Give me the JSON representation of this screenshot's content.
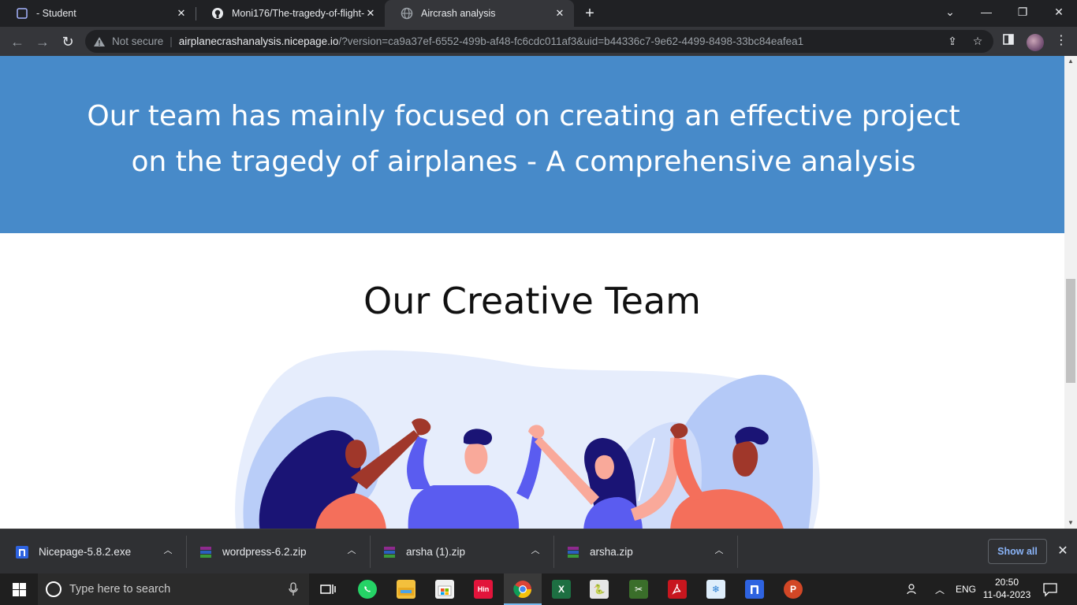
{
  "browser": {
    "tabs": [
      {
        "title": "- Student",
        "icon": "teams-icon",
        "active": false
      },
      {
        "title": "Moni176/The-tragedy-of-flight-",
        "icon": "github-icon",
        "active": false
      },
      {
        "title": "Aircrash analysis",
        "icon": "globe-icon",
        "active": true
      }
    ],
    "address": {
      "security_label": "Not secure",
      "host": "airplanecrashanalysis.nicepage.io",
      "path": "/?version=ca9a37ef-6552-499b-af48-fc6cdc011af3&uid=b44336c7-9e62-4499-8498-33bc84eafea1"
    }
  },
  "page": {
    "hero_text": "Our team has mainly focused on creating an effective project on the tragedy of airplanes - A comprehensive analysis",
    "team_heading": "Our Creative Team",
    "colors": {
      "hero_bg": "#478ac9",
      "blob": "#dde6fb",
      "leaf": "#b4c9f7",
      "shirt_blue": "#5a5cf0",
      "shirt_coral": "#f46f5b",
      "hair_navy": "#1a1475"
    }
  },
  "downloads": {
    "items": [
      {
        "name": "Nicepage-5.8.2.exe",
        "icon": "nicepage-icon"
      },
      {
        "name": "wordpress-6.2.zip",
        "icon": "winrar-icon"
      },
      {
        "name": "arsha (1).zip",
        "icon": "winrar-icon"
      },
      {
        "name": "arsha.zip",
        "icon": "winrar-icon"
      }
    ],
    "show_all": "Show all"
  },
  "taskbar": {
    "search_placeholder": "Type here to search",
    "pinned": [
      "task-view-icon",
      "whatsapp-icon",
      "file-explorer-icon",
      "microsoft-store-icon",
      "hin-icon",
      "chrome-icon",
      "excel-icon",
      "python-idle-icon",
      "snipping-tool-icon",
      "acrobat-icon",
      "snowflake-app-icon",
      "nicepage-icon",
      "powerpoint-icon"
    ],
    "hin_label": "Hin",
    "language": "ENG",
    "time": "20:50",
    "date": "11-04-2023"
  }
}
